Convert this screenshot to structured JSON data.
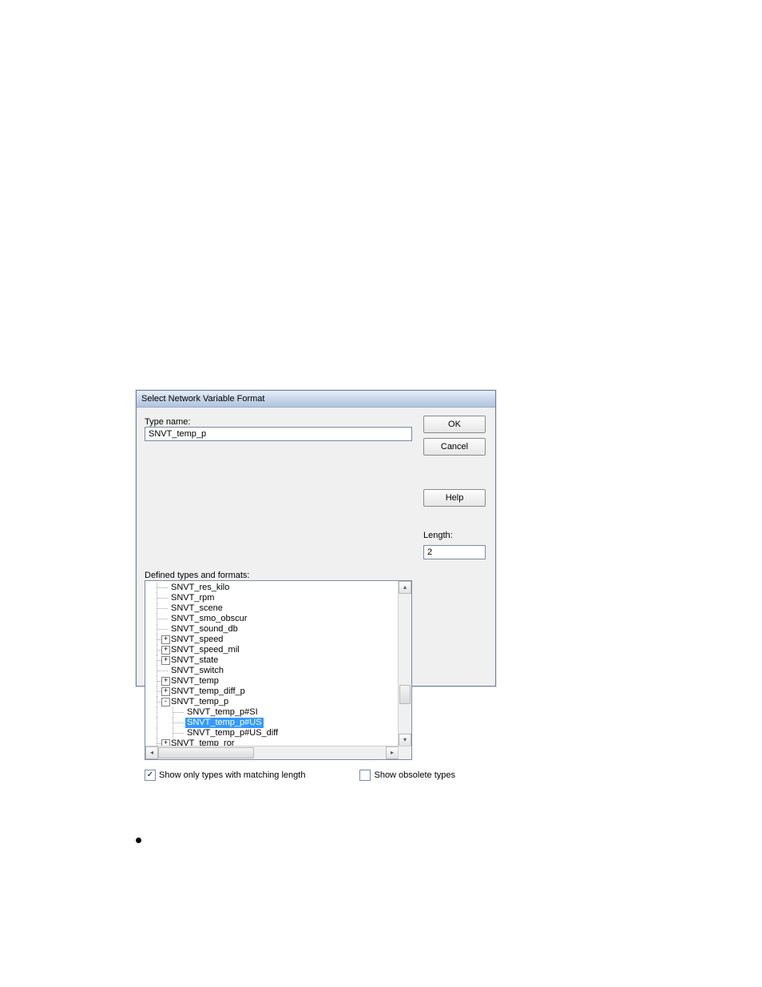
{
  "dialog": {
    "title": "Select Network Variable Format",
    "typeNameLabel": "Type name:",
    "typeNameValue": "SNVT_temp_p",
    "definedTypesLabel": "Defined types and formats:",
    "lengthLabel": "Length:",
    "lengthValue": "2",
    "okLabel": "OK",
    "cancelLabel": "Cancel",
    "helpLabel": "Help",
    "showOnlyMatchingLabel": "Show only types with matching length",
    "showOnlyMatchingChecked": true,
    "showObsoleteLabel": "Show obsolete types",
    "showObsoleteChecked": false,
    "tree": [
      {
        "label": "SNVT_res_kilo",
        "level": 2,
        "expander": null
      },
      {
        "label": "SNVT_rpm",
        "level": 2,
        "expander": null
      },
      {
        "label": "SNVT_scene",
        "level": 2,
        "expander": null
      },
      {
        "label": "SNVT_smo_obscur",
        "level": 2,
        "expander": null
      },
      {
        "label": "SNVT_sound_db",
        "level": 2,
        "expander": null
      },
      {
        "label": "SNVT_speed",
        "level": 2,
        "expander": "+"
      },
      {
        "label": "SNVT_speed_mil",
        "level": 2,
        "expander": "+"
      },
      {
        "label": "SNVT_state",
        "level": 2,
        "expander": "+"
      },
      {
        "label": "SNVT_switch",
        "level": 2,
        "expander": null
      },
      {
        "label": "SNVT_temp",
        "level": 2,
        "expander": "+"
      },
      {
        "label": "SNVT_temp_diff_p",
        "level": 2,
        "expander": "+"
      },
      {
        "label": "SNVT_temp_p",
        "level": 2,
        "expander": "-"
      },
      {
        "label": "SNVT_temp_p#SI",
        "level": 3,
        "expander": null
      },
      {
        "label": "SNVT_temp_p#US",
        "level": 3,
        "expander": null,
        "selected": true
      },
      {
        "label": "SNVT_temp_p#US_diff",
        "level": 3,
        "expander": null
      },
      {
        "label": "SNVT_temp_ror",
        "level": 2,
        "expander": "+"
      }
    ]
  }
}
